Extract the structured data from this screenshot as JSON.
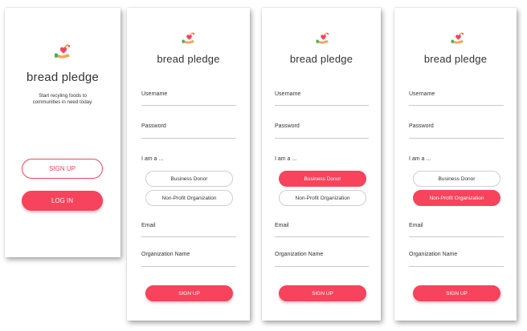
{
  "brand": {
    "name": "bread pledge"
  },
  "welcome": {
    "tagline_line1": "Start recyling foods to",
    "tagline_line2": "communities in need today.",
    "signup_label": "SIGN UP",
    "login_label": "LOG IN"
  },
  "signup_form": {
    "username_label": "Username",
    "password_label": "Password",
    "iam_label": "I am a ...",
    "role_options": [
      "Business Donor",
      "Non-Profit Organization"
    ],
    "email_label": "Email",
    "org_name_label": "Organization Name",
    "submit_label": "SIGN UP"
  },
  "screens": [
    {
      "selected_role": "none"
    },
    {
      "selected_role": "Business Donor"
    },
    {
      "selected_role": "Non-Profit Organization"
    }
  ],
  "colors": {
    "accent": "#f7435b",
    "text": "#333333",
    "divider": "#c9c9c9"
  }
}
